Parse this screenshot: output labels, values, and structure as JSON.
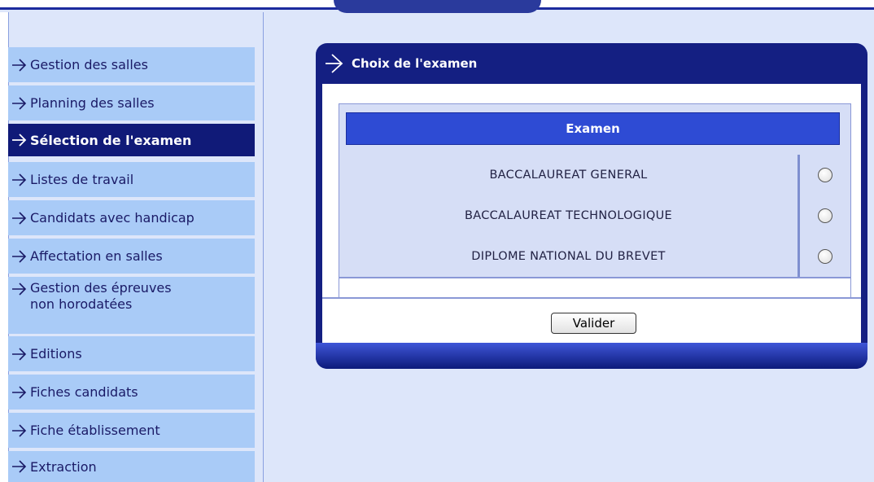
{
  "sidebar": {
    "items": [
      {
        "label": "Gestion des salles"
      },
      {
        "label": "Planning des salles"
      },
      {
        "label": "Sélection de l'examen",
        "active": true
      },
      {
        "label": "Listes de travail"
      },
      {
        "label": "Candidats avec handicap"
      },
      {
        "label": "Affectation en salles"
      },
      {
        "label": "Gestion des épreuves",
        "label_line2": "non horodatées"
      },
      {
        "label": "Editions"
      },
      {
        "label": "Fiches candidats"
      },
      {
        "label": "Fiche établissement"
      },
      {
        "label": "Extraction"
      }
    ],
    "icon": "arrow-right-icon"
  },
  "panel": {
    "title": "Choix de l'examen",
    "table": {
      "header": "Examen",
      "rows": [
        {
          "label": "BACCALAUREAT GENERAL",
          "selected": false
        },
        {
          "label": "BACCALAUREAT TECHNOLOGIQUE",
          "selected": false
        },
        {
          "label": "DIPLOME NATIONAL DU BREVET",
          "selected": false
        }
      ]
    },
    "submit_label": "Valider"
  },
  "colors": {
    "background": "#dde6fa",
    "menu_item": "#a9cbf7",
    "menu_active": "#101a78",
    "panel": "#141f82",
    "table_header": "#2e4bd4"
  }
}
